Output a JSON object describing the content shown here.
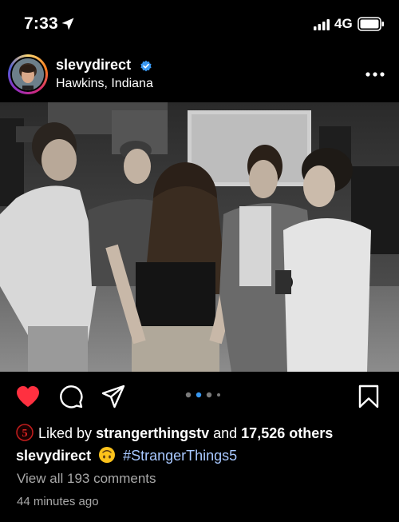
{
  "status_bar": {
    "time": "7:33",
    "network": "4G"
  },
  "post": {
    "username": "slevydirect",
    "location": "Hawkins, Indiana",
    "likes": {
      "prefix": "Liked by",
      "liked_by_user": "strangerthingstv",
      "joiner": "and",
      "others": "17,526 others"
    },
    "caption": {
      "username": "slevydirect",
      "hashtag": "#StrangerThings5"
    },
    "view_comments": "View all 193 comments",
    "time_ago": "44 minutes ago",
    "carousel": {
      "total": 4,
      "active_index": 1
    }
  },
  "colors": {
    "background": "#000000",
    "like_red": "#ff3040",
    "verified_blue": "#3897f0",
    "hashtag": "#a8c8ff",
    "muted_text": "#a8a8a8",
    "carousel_active": "#3897f0"
  },
  "icons": [
    "location-arrow-icon",
    "signal-icon",
    "battery-icon",
    "verified-icon",
    "more-icon",
    "heart-icon",
    "comment-icon",
    "share-icon",
    "bookmark-icon",
    "upside-down-face-emoji",
    "stranger-things-5-badge"
  ]
}
